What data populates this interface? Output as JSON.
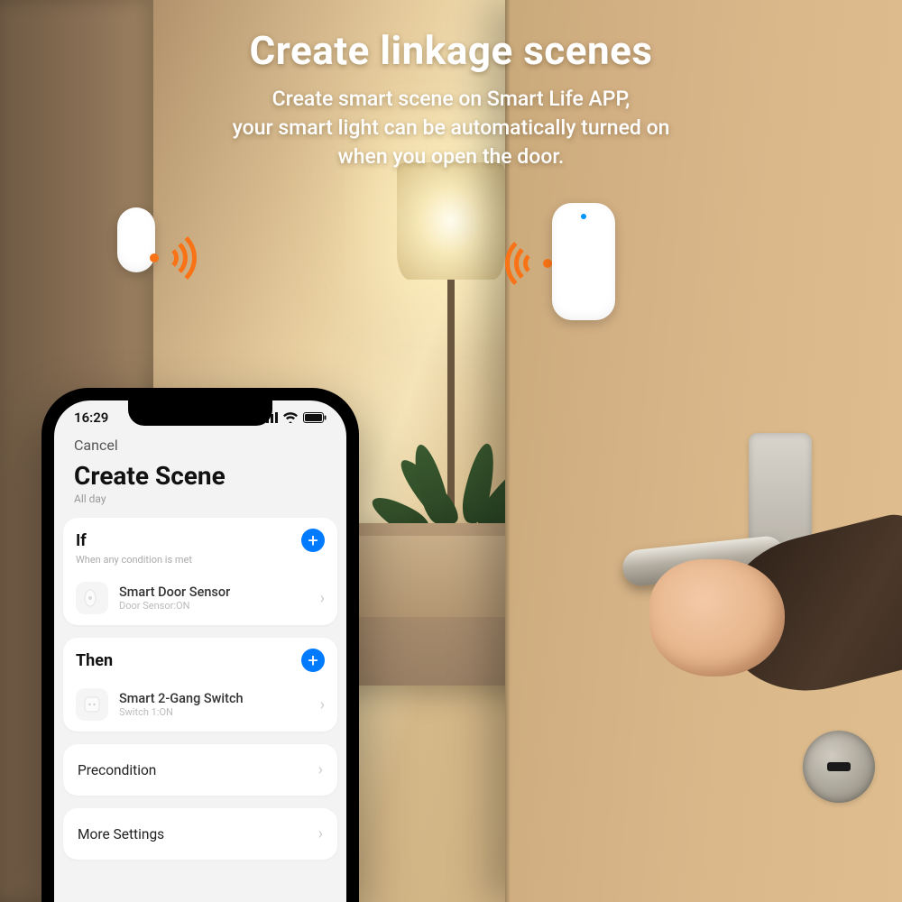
{
  "marketing": {
    "headline": "Create linkage scenes",
    "sub_line1": "Create smart scene on Smart Life APP,",
    "sub_line2": "your smart light can be automatically turned on",
    "sub_line3": "when you open the door."
  },
  "phone": {
    "status": {
      "time": "16:29"
    },
    "cancel": "Cancel",
    "title": "Create Scene",
    "subtitle": "All day",
    "if_block": {
      "title": "If",
      "subtitle": "When any condition is met",
      "device_name": "Smart Door Sensor",
      "device_status": "Door Sensor:ON"
    },
    "then_block": {
      "title": "Then",
      "device_name": "Smart 2-Gang Switch",
      "device_status": "Switch 1:ON"
    },
    "precondition": "Precondition",
    "more_settings": "More Settings"
  }
}
